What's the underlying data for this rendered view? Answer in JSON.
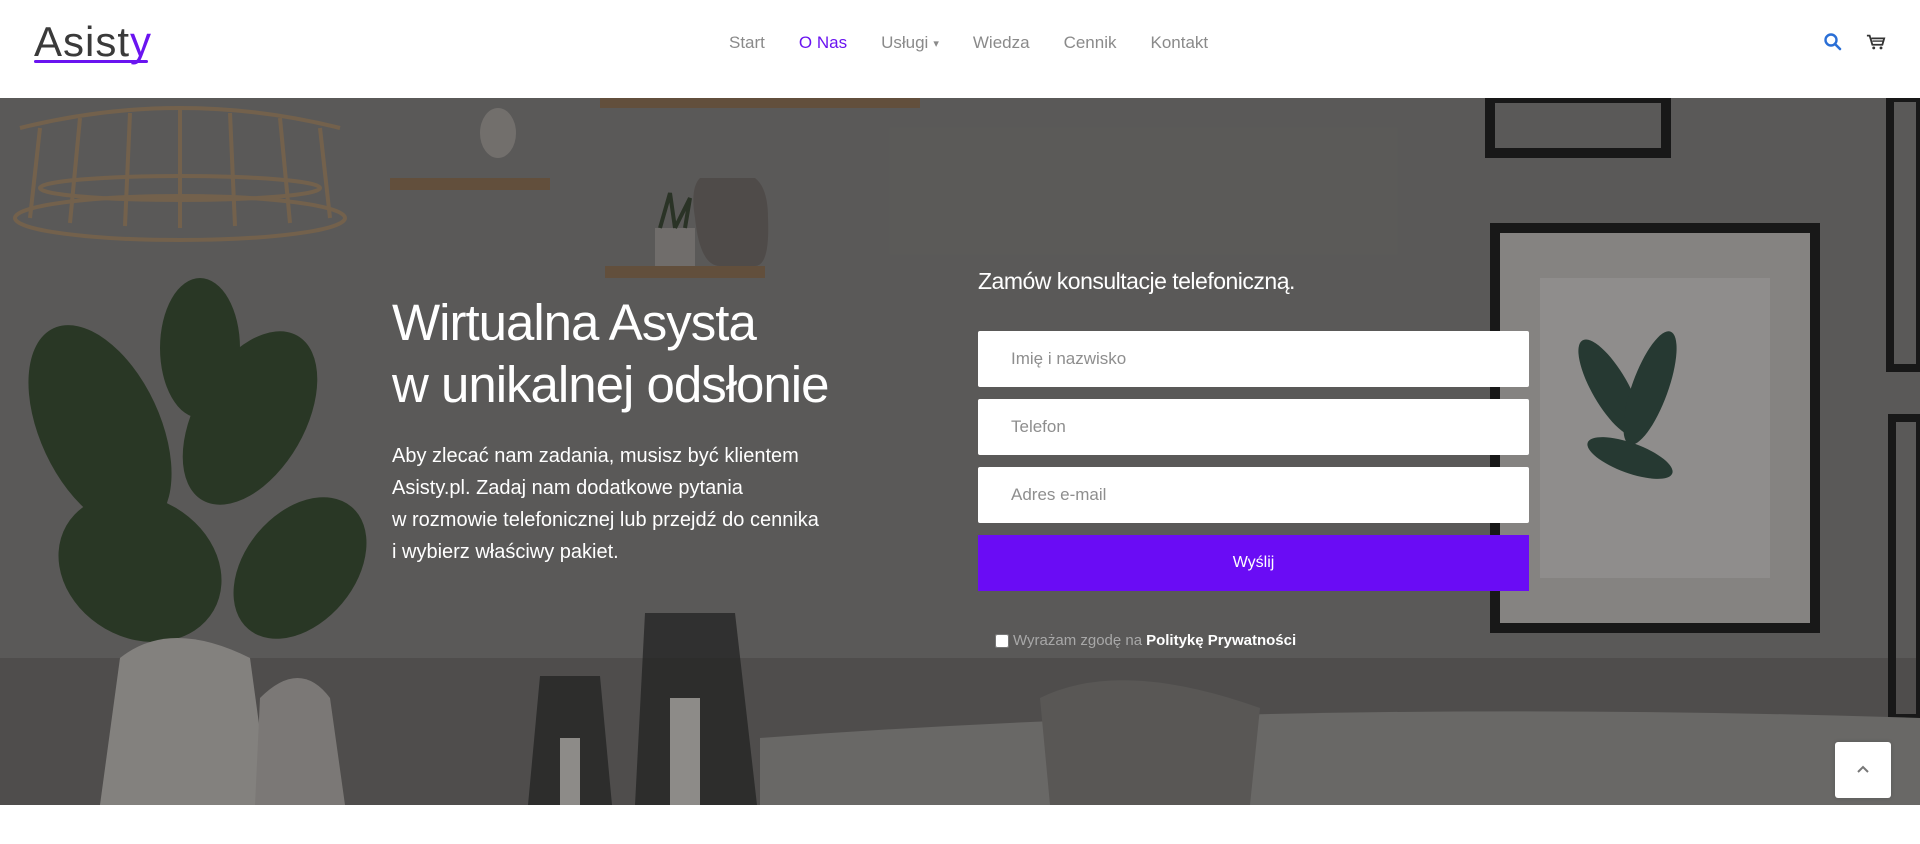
{
  "header": {
    "logo": {
      "text_main": "Asist",
      "text_accent": "y"
    },
    "nav": [
      {
        "label": "Start",
        "active": false
      },
      {
        "label": "O Nas",
        "active": true
      },
      {
        "label": "Usługi",
        "active": false,
        "dropdown": true
      },
      {
        "label": "Wiedza",
        "active": false
      },
      {
        "label": "Cennik",
        "active": false
      },
      {
        "label": "Kontakt",
        "active": false
      }
    ],
    "icons": [
      "search-icon",
      "cart-icon"
    ]
  },
  "hero": {
    "headline_line1": "Wirtualna Asysta",
    "headline_line2": "w unikalnej odsłonie",
    "description_lines": [
      "Aby zlecać nam zadania, musisz być klientem",
      "Asisty.pl. Zadaj nam dodatkowe pytania",
      "w rozmowie telefonicznej lub przejdź do cennika",
      "i wybierz właściwy pakiet."
    ]
  },
  "form": {
    "title": "Zamów konsultacje telefoniczną.",
    "name_placeholder": "Imię i nazwisko",
    "phone_placeholder": "Telefon",
    "email_placeholder": "Adres e-mail",
    "submit_label": "Wyślij",
    "consent_text": "Wyrażam zgodę na",
    "consent_link": "Politykę Prywatności"
  },
  "colors": {
    "accent": "#6a0cf5",
    "nav_active": "#6a14f0",
    "nav_text": "#8a8a8a"
  },
  "back_to_top_icon": "chevron-up-icon"
}
